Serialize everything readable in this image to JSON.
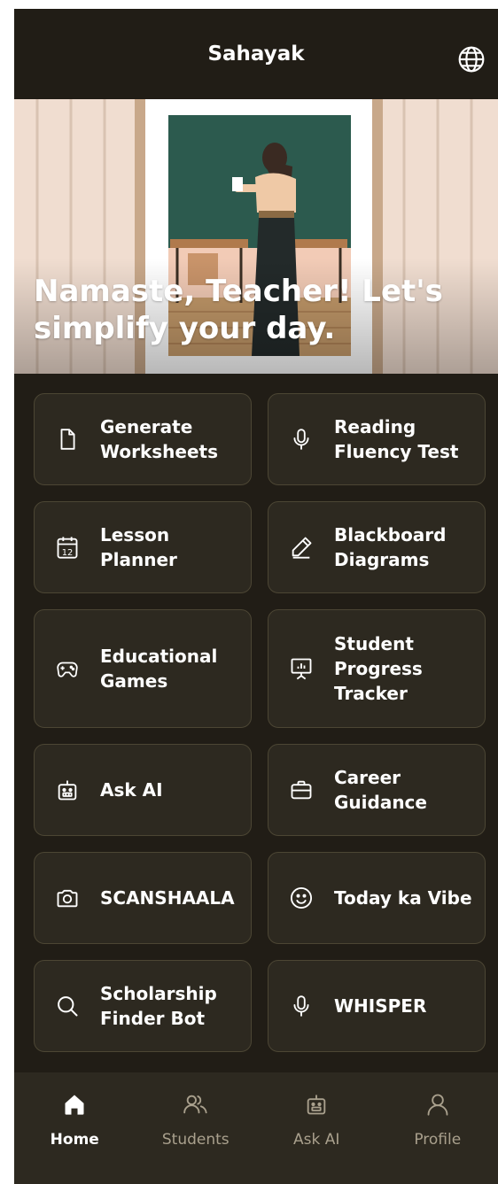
{
  "header": {
    "title": "Sahayak",
    "language_icon": "globe-icon"
  },
  "hero": {
    "greeting": "Namaste, Teacher! Let's simplify your day."
  },
  "features": [
    {
      "label": "Generate Worksheets",
      "icon": "document-icon"
    },
    {
      "label": "Reading Fluency Test",
      "icon": "microphone-icon"
    },
    {
      "label": "Lesson Planner",
      "icon": "calendar-icon",
      "icon_text": "12"
    },
    {
      "label": "Blackboard Diagrams",
      "icon": "pencil-icon"
    },
    {
      "label": "Educational Games",
      "icon": "gamepad-icon"
    },
    {
      "label": "Student Progress Tracker",
      "icon": "presentation-chart-icon"
    },
    {
      "label": "Ask AI",
      "icon": "robot-icon"
    },
    {
      "label": "Career Guidance",
      "icon": "briefcase-icon"
    },
    {
      "label": "SCANSHAALA",
      "icon": "camera-icon"
    },
    {
      "label": "Today ka Vibe",
      "icon": "smiley-icon"
    },
    {
      "label": "Scholarship Finder Bot",
      "icon": "search-icon"
    },
    {
      "label": "WHISPER",
      "icon": "microphone-icon"
    }
  ],
  "nav": [
    {
      "label": "Home",
      "icon": "home-icon",
      "active": true
    },
    {
      "label": "Students",
      "icon": "users-icon",
      "active": false
    },
    {
      "label": "Ask AI",
      "icon": "robot-icon",
      "active": false
    },
    {
      "label": "Profile",
      "icon": "user-icon",
      "active": false
    }
  ],
  "colors": {
    "background": "#211d16",
    "card": "#2d2920",
    "card_border": "#4c4634",
    "text": "#ffffff",
    "nav_inactive": "#a9a08d"
  }
}
